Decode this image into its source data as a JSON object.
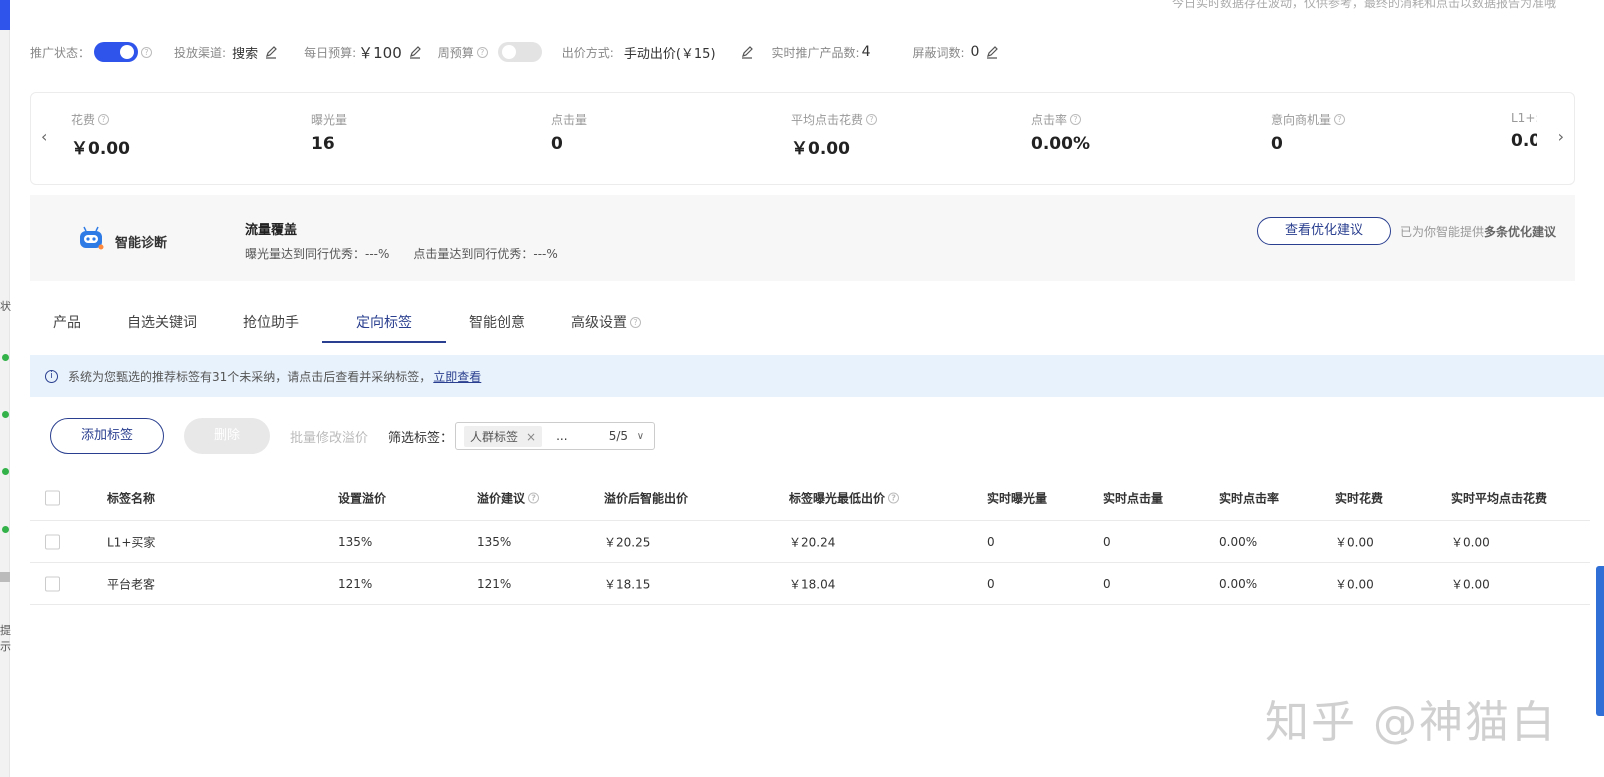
{
  "top_note": "今日实时数据存在波动，仅供参考，最终的消耗和点击以数据报告为准哦",
  "status": {
    "promo_label": "推广状态：",
    "promo_on": true,
    "channel_label": "投放渠道:",
    "channel_value": "搜索",
    "daily_budget_label": "每日预算:",
    "daily_budget_value": "￥100",
    "weekly_budget_label": "周预算",
    "weekly_on": false,
    "bid_mode_label": "出价方式:",
    "bid_mode_value": "手动出价(￥15)",
    "products_label": "实时推广产品数:",
    "products_value": "4",
    "blocked_label": "屏蔽词数:",
    "blocked_value": "0"
  },
  "metrics": [
    {
      "label": "花费",
      "value": "￥0.00",
      "help": true
    },
    {
      "label": "曝光量",
      "value": "16",
      "help": false
    },
    {
      "label": "点击量",
      "value": "0",
      "help": false
    },
    {
      "label": "平均点击花费",
      "value": "￥0.00",
      "help": true
    },
    {
      "label": "点击率",
      "value": "0.00%",
      "help": true
    },
    {
      "label": "意向商机量",
      "value": "0",
      "help": true
    },
    {
      "label": "L1+:",
      "value": "0.0",
      "help": false
    }
  ],
  "diagnosis": {
    "title": "智能诊断",
    "section_title": "流量覆盖",
    "section_desc": "曝光量达到同行优秀：---%　　点击量达到同行优秀：---%",
    "button": "查看优化建议",
    "hint_prefix": "已为你智能提供",
    "hint_bold": "多条优化建议"
  },
  "tabs": [
    {
      "label": "产品",
      "active": false
    },
    {
      "label": "自选关键词",
      "active": false
    },
    {
      "label": "抢位助手",
      "active": false
    },
    {
      "label": "定向标签",
      "active": true
    },
    {
      "label": "智能创意",
      "active": false
    },
    {
      "label": "高级设置",
      "active": false
    }
  ],
  "notice": {
    "text": "系统为您甄选的推荐标签有31个未采纳，请点击后查看并采纳标签，",
    "link": "立即查看"
  },
  "toolbar": {
    "add": "添加标签",
    "delete": "删除",
    "batch": "批量修改溢价",
    "filter_label": "筛选标签：",
    "chip": "人群标签",
    "more": "...",
    "count": "5/5"
  },
  "table": {
    "headers": [
      "标签名称",
      "设置溢价",
      "溢价建议",
      "溢价后智能出价",
      "标签曝光最低出价",
      "实时曝光量",
      "实时点击量",
      "实时点击率",
      "实时花费",
      "实时平均点击花费"
    ],
    "rows": [
      [
        "L1+买家",
        "135%",
        "135%",
        "￥20.25",
        "￥20.24",
        "0",
        "0",
        "0.00%",
        "￥0.00",
        "￥0.00"
      ],
      [
        "平台老客",
        "121%",
        "121%",
        "￥18.15",
        "￥18.04",
        "0",
        "0",
        "0.00%",
        "￥0.00",
        "￥0.00"
      ]
    ]
  },
  "left_strip": {
    "text1": "状",
    "text2": "提示"
  },
  "watermark": "知乎 @神猫白",
  "colors": {
    "accent": "#2f54eb",
    "brand_dark": "#2a3f8f",
    "notice_bg": "#e8f2fc"
  }
}
